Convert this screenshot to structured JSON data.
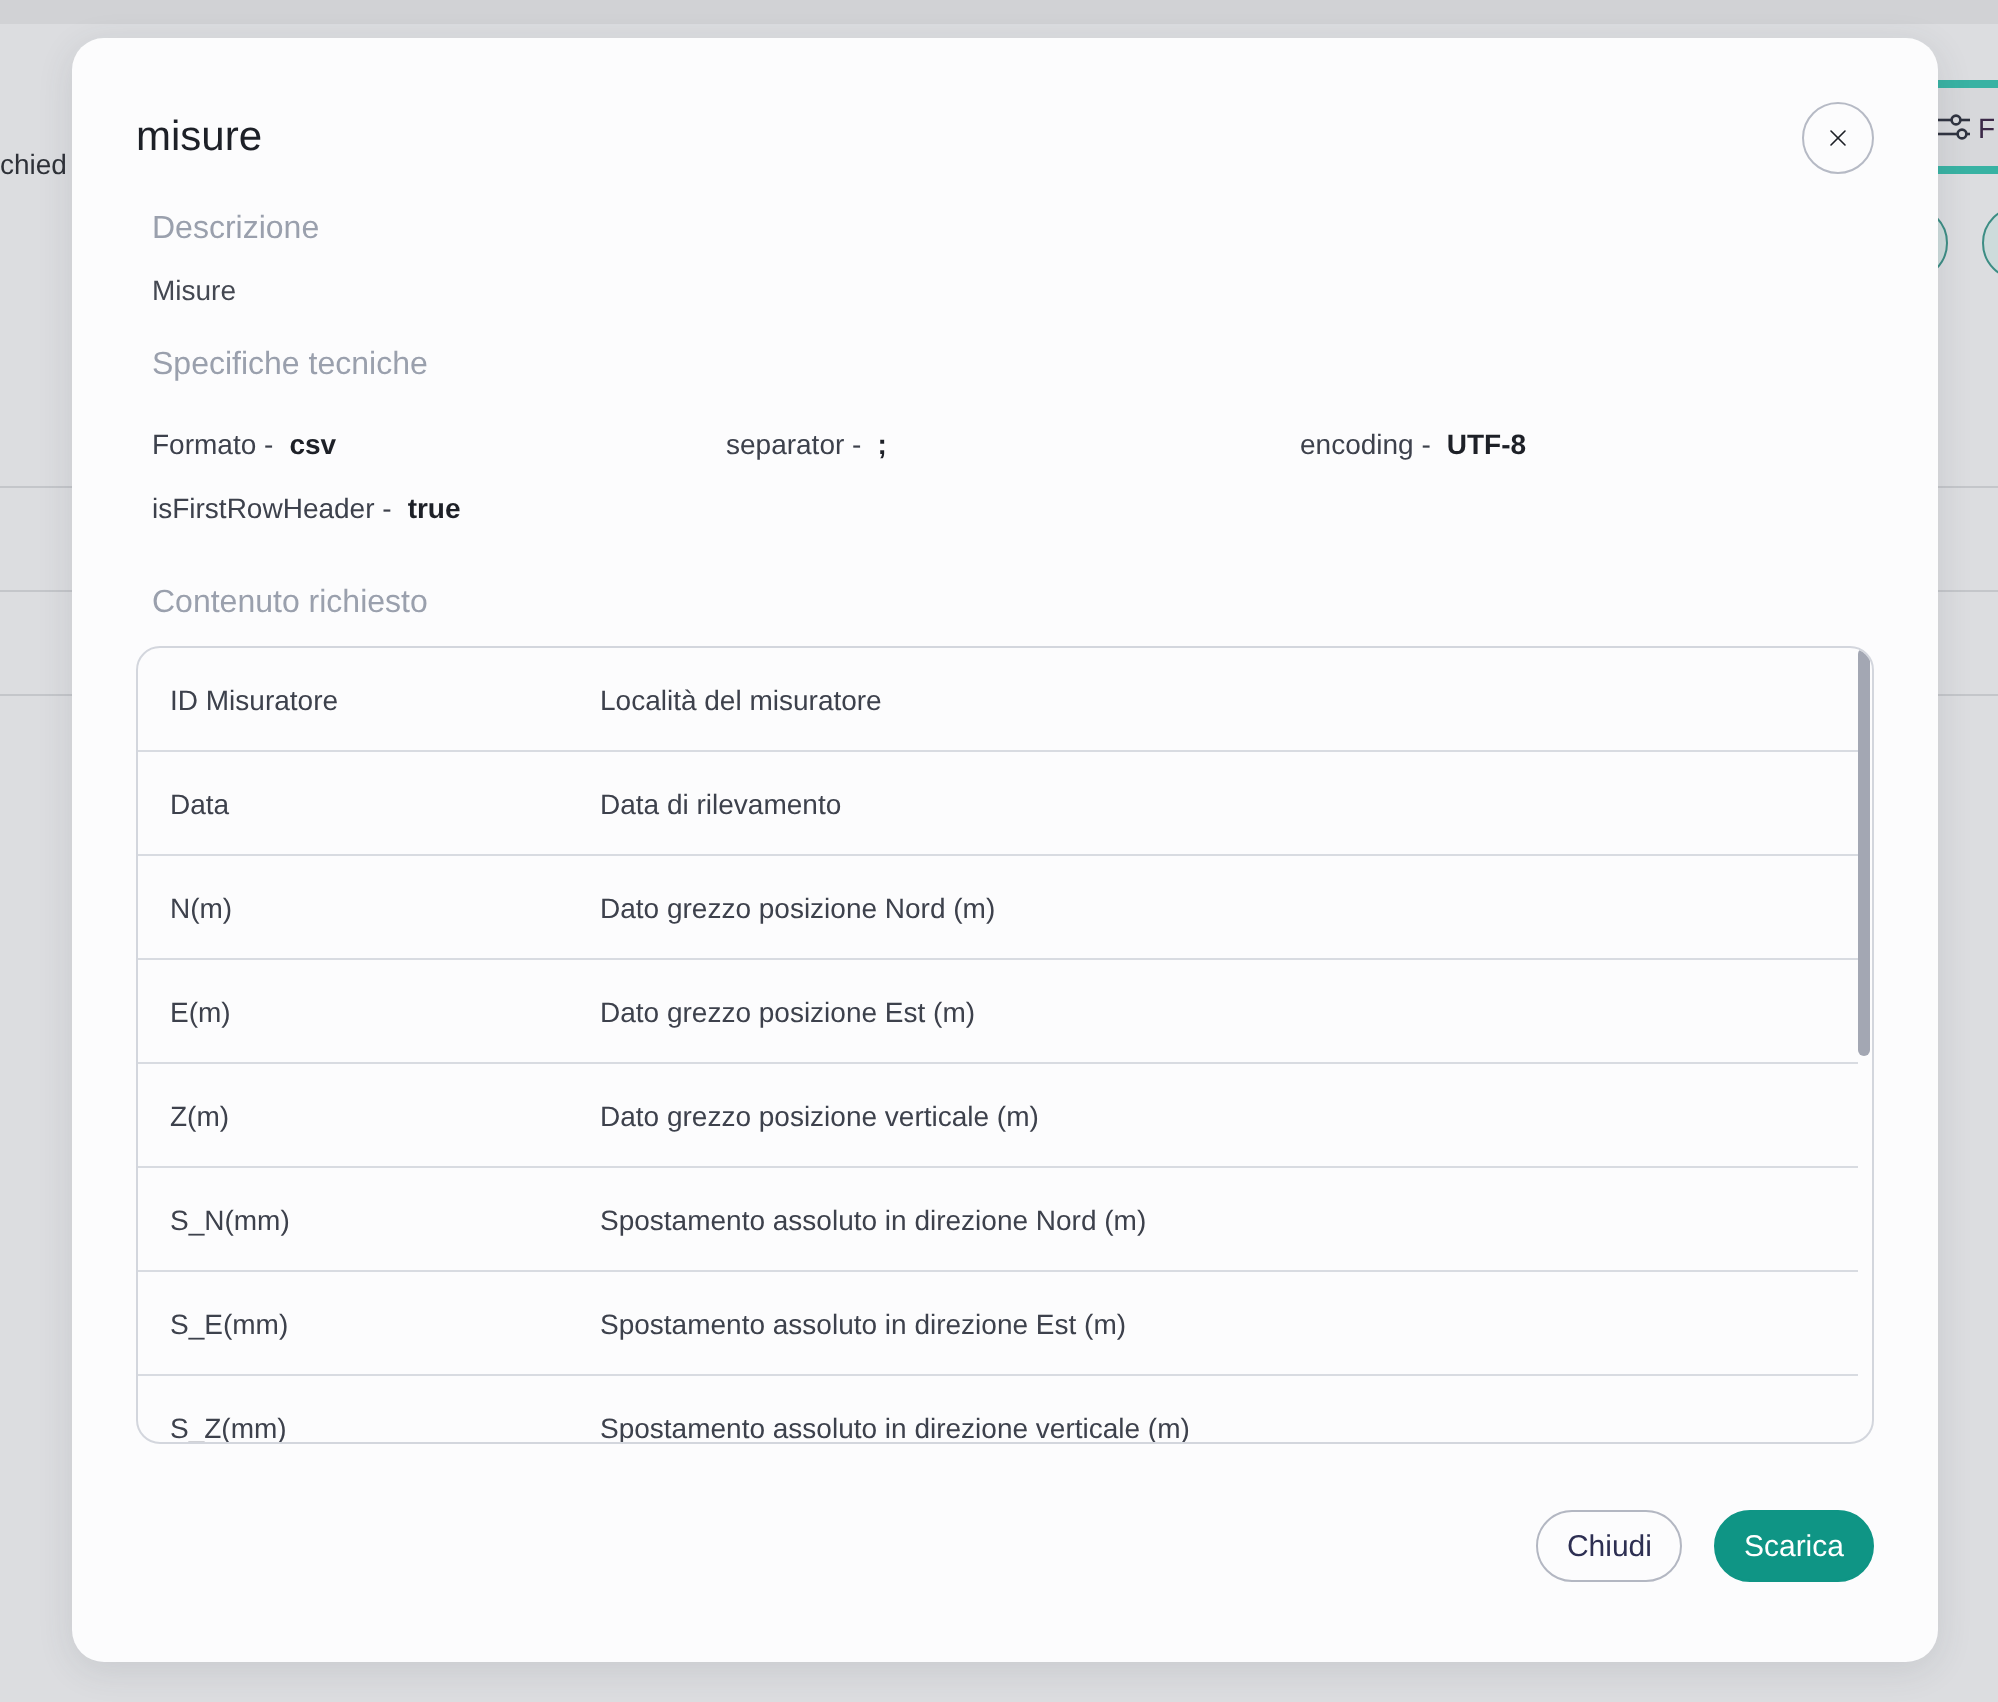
{
  "background": {
    "page_text": "chied",
    "filter_button": {
      "label": "F"
    }
  },
  "dialog": {
    "title": "misure",
    "description": {
      "heading": "Descrizione",
      "text": "Misure"
    },
    "specs": {
      "heading": "Specifiche tecniche",
      "items": [
        {
          "label": "Formato -",
          "value": "csv"
        },
        {
          "label": "separator -",
          "value": ";"
        },
        {
          "label": "encoding -",
          "value": "UTF-8"
        },
        {
          "label": "isFirstRowHeader -",
          "value": "true"
        }
      ]
    },
    "content": {
      "heading": "Contenuto richiesto",
      "rows": [
        {
          "field": "ID Misuratore",
          "description": "Località del misuratore"
        },
        {
          "field": "Data",
          "description": "Data di rilevamento"
        },
        {
          "field": "N(m)",
          "description": "Dato grezzo posizione Nord (m)"
        },
        {
          "field": "E(m)",
          "description": "Dato grezzo posizione Est (m)"
        },
        {
          "field": "Z(m)",
          "description": "Dato grezzo posizione verticale (m)"
        },
        {
          "field": "S_N(mm)",
          "description": "Spostamento assoluto in direzione Nord (m)"
        },
        {
          "field": "S_E(mm)",
          "description": "Spostamento assoluto in direzione Est (m)"
        },
        {
          "field": "S_Z(mm)",
          "description": "Spostamento assoluto in direzione verticale (m)"
        }
      ]
    },
    "buttons": [
      {
        "label": "Chiudi",
        "kind": "secondary"
      },
      {
        "label": "Scarica",
        "kind": "primary"
      }
    ]
  }
}
